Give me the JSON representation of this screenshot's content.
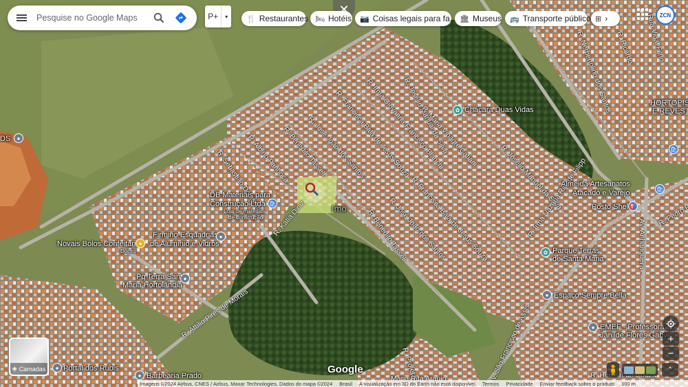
{
  "search": {
    "placeholder": "Pesquise no Google Maps"
  },
  "travel_mode_chip": "P+",
  "chips": [
    {
      "icon": "🍴",
      "label": "Restaurantes"
    },
    {
      "icon": "🛏",
      "label": "Hotéis"
    },
    {
      "icon": "📷",
      "label": "Coisas legais para fa..."
    },
    {
      "icon": "🏛",
      "label": "Museus"
    },
    {
      "icon": "🚌",
      "label": "Transporte público"
    }
  ],
  "avatar_text": "ZCN",
  "places": {
    "chacara": "Chácara Duas Vidas",
    "almeida_1": "Almeida Artesanatos",
    "almeida_2": "Atacado e Varejo",
    "posto": "Posto Shell",
    "hortopiso_1": "HORTOPISO",
    "hortopiso_2": "E REVESTIM",
    "db_1": "DB Materiais para",
    "db_2": "Construção Ltda",
    "db_3": "Loja de materiais",
    "db_4": "de construção",
    "firmino_1": "Firmino Esquadrias",
    "firmino_2": "de Alumínio e Vidros",
    "novais_1": "Novais Bolos Confeitaria",
    "novais_2": "Doces",
    "praca_1": "Pq Terra Santa",
    "praca_2": "Maria Hortolândia",
    "parque_1": "Parque Terras",
    "parque_2": "de Santa Maria",
    "espaco": "Espaço Sempre Bella",
    "emef_1": "EMEF - Professora",
    "emef_2": "Janilde Flores Gaby",
    "portal": "Portal dos Rubis",
    "barbearia": "Barbearia Prado",
    "ds": "DS"
  },
  "streets": [
    "R. Josélio Manual da Silva",
    "R. Irma Giovanna Francisco Bianchi",
    "R. Francisca Bala de Jesus Souza",
    "R. Maria Vinagre Catiani",
    "R. José João dos Santos",
    "R. Benedito Tasseli",
    "R. Albino Panhoca",
    "R. Sebastião Donisetti",
    "R. Kátia Diniz",
    "R. Josélio Manuel da Silva",
    "R. Francisca Bala de Jesus Souza",
    "R. José João dos Santos",
    "R. Benedito Tasseli",
    "R. Irma Nazaria Rita de Filipp",
    "Av. Anhanguera",
    "R. Pedro Be",
    "R. Attílio Pires de Morais",
    "R. Projetada",
    "R. Herbert de Souza",
    "Av. São Francisco de Assis",
    "Maria Rita Araújo",
    "R. Ricardo",
    "R. Nerbertolino dos Santos",
    "Rua Vidal Filho"
  ],
  "layers_label": "Camadas",
  "google_logo": "Google",
  "watermark": "Imo",
  "footer": {
    "imagery": "Imagens ©2024 Airbus, CNES / Airbus, Maxar Technologies, Dados do mapa ©2024",
    "country": "Brasil",
    "note": "A visualização em 3D do Earth não está disponível",
    "terms": "Termos",
    "privacy": "Privacidade",
    "feedback": "Enviar feedback sobre o produto",
    "scale": "100 m"
  },
  "colors": {
    "grass": "#7d8a52",
    "forest": "#2f4a22",
    "dirt": "#b85a2a",
    "road": "#a8a8a0",
    "pin_blue": "#4a7fd4",
    "highlight": "#c9e37a"
  },
  "icons": {
    "menu": "menu-icon",
    "search": "search-icon",
    "directions": "directions-icon",
    "close": "close-icon",
    "apps": "apps-grid-icon",
    "more": "chevron-right-icon",
    "pegman": "pegman-icon",
    "location": "my-location-icon",
    "zoom_in": "plus-icon",
    "zoom_out": "minus-icon"
  }
}
